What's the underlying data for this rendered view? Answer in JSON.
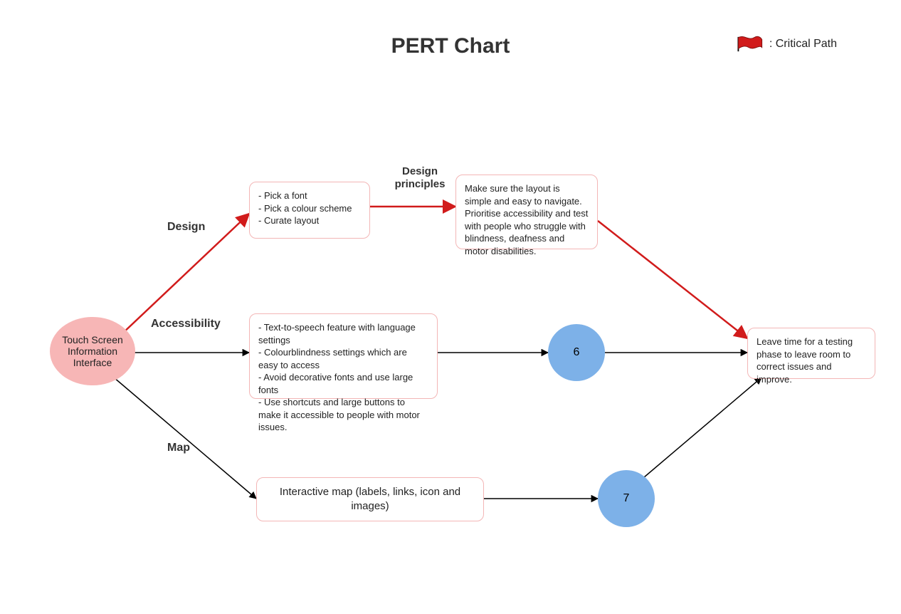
{
  "title": "PERT Chart",
  "legend_label": ": Critical Path",
  "nodes": {
    "start": "Touch Screen Information Interface",
    "design_box": "- Pick a font\n- Pick a colour scheme\n- Curate layout",
    "principles_box": "Make sure the layout is simple and easy to navigate. Prioritise accessibility and test with people who struggle with blindness, deafness and motor disabilities.",
    "accessibility_box": "- Text-to-speech feature with language settings\n- Colourblindness settings which are easy to access\n- Avoid decorative fonts and use large fonts\n- Use shortcuts and large buttons to make it accessible to people with motor issues.",
    "node6": "6",
    "map_box": "Interactive map (labels, links, icon and images)",
    "node7": "7",
    "end_box": "Leave time for a testing phase to leave room to correct issues and improve."
  },
  "edge_labels": {
    "design": "Design",
    "accessibility": "Accessibility",
    "map": "Map",
    "design_principles": "Design principles"
  },
  "colors": {
    "critical_red": "#d11b1b",
    "pink_node": "#f7b6b6",
    "blue_node": "#7db1e8",
    "box_border": "#f3b6b6"
  }
}
